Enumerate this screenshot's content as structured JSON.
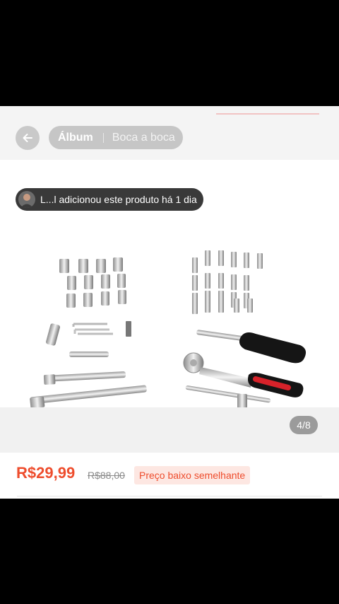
{
  "header": {
    "tabs": [
      {
        "label": "Álbum",
        "active": true
      },
      {
        "label": "Boca a boca",
        "active": false
      }
    ],
    "back_icon": "back-arrow-icon"
  },
  "notice": {
    "text": "L...l adicionou este produto há 1 dia"
  },
  "gallery": {
    "counter": "4/8"
  },
  "price": {
    "current": "R$29,99",
    "original": "R$88,00",
    "badge": "Preço baixo semelhante"
  },
  "colors": {
    "accent": "#ee4d2d",
    "badge_bg": "#fde7e2"
  }
}
